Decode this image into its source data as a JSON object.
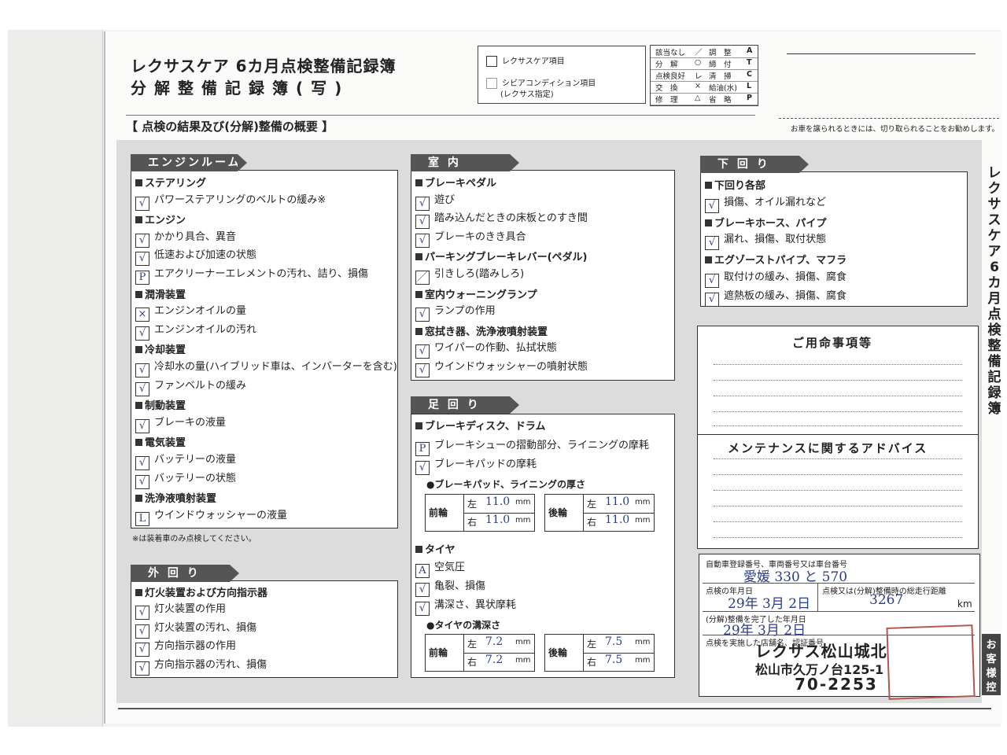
{
  "header": {
    "title_line1": "レクサスケア 6カ月点検整備記録簿",
    "title_line2": "分解整備記録簿(写)",
    "legend": {
      "lexus_care_item": "レクサスケア項目",
      "severe_condition_item": "シビアコンディション項目",
      "severe_condition_note": "(レクサス指定)"
    },
    "codes": [
      {
        "left": "該当なし",
        "left_sym": "／",
        "right": "調　整",
        "right_sym": "A"
      },
      {
        "left": "分　解",
        "left_sym": "○",
        "right": "締　付",
        "right_sym": "T"
      },
      {
        "left": "点検良好",
        "left_sym": "レ",
        "right": "清　掃",
        "right_sym": "C"
      },
      {
        "left": "交　換",
        "left_sym": "×",
        "right": "給油(水)",
        "right_sym": "L"
      },
      {
        "left": "修　理",
        "left_sym": "△",
        "right": "省　略",
        "right_sym": "P"
      }
    ],
    "detach_note": "お車を譲られるときには、切り取られることをお勧めします。",
    "summary_heading": "【 点検の結果及び(分解)整備の概要 】"
  },
  "engine_room": {
    "tab": "エンジンルーム",
    "sections": [
      {
        "heading": "ステアリング",
        "items": [
          {
            "label": "パワーステアリングのベルトの緩み※",
            "mark": "√"
          }
        ]
      },
      {
        "heading": "エンジン",
        "items": [
          {
            "label": "かかり具合、異音",
            "mark": "√"
          },
          {
            "label": "低速および加速の状態",
            "mark": "√"
          },
          {
            "label": "エアクリーナーエレメントの汚れ、詰り、損傷",
            "mark": "P"
          }
        ]
      },
      {
        "heading": "潤滑装置",
        "items": [
          {
            "label": "エンジンオイルの量",
            "mark": "×"
          },
          {
            "label": "エンジンオイルの汚れ",
            "mark": "√"
          }
        ]
      },
      {
        "heading": "冷却装置",
        "items": [
          {
            "label": "冷却水の量(ハイブリッド車は、インバーターを含む)",
            "mark": "√"
          },
          {
            "label": "ファンベルトの緩み",
            "mark": "√"
          }
        ]
      },
      {
        "heading": "制動装置",
        "items": [
          {
            "label": "ブレーキの液量",
            "mark": "√"
          }
        ]
      },
      {
        "heading": "電気装置",
        "items": [
          {
            "label": "バッテリーの液量",
            "mark": "√"
          },
          {
            "label": "バッテリーの状態",
            "mark": "√"
          }
        ]
      },
      {
        "heading": "洗浄液噴射装置",
        "items": [
          {
            "label": "ウインドウォッシャーの液量",
            "mark": "L"
          }
        ]
      }
    ],
    "footnote": "※は装着車のみ点検してください。"
  },
  "exterior": {
    "tab": "外 回 り",
    "heading": "灯火装置および方向指示器",
    "items": [
      {
        "label": "灯火装置の作用",
        "mark": "√"
      },
      {
        "label": "灯火装置の汚れ、損傷",
        "mark": "√"
      },
      {
        "label": "方向指示器の作用",
        "mark": "√"
      },
      {
        "label": "方向指示器の汚れ、損傷",
        "mark": "√"
      }
    ]
  },
  "interior": {
    "tab": "室 内",
    "sections": [
      {
        "heading": "ブレーキペダル",
        "items": [
          {
            "label": "遊び",
            "mark": "√"
          },
          {
            "label": "踏み込んだときの床板とのすき間",
            "mark": "√"
          },
          {
            "label": "ブレーキのきき具合",
            "mark": "√"
          }
        ]
      },
      {
        "heading": "パーキングブレーキレバー(ペダル)",
        "items": [
          {
            "label": "引きしろ(踏みしろ)",
            "mark": "／"
          }
        ]
      },
      {
        "heading": "室内ウォーニングランプ",
        "items": [
          {
            "label": "ランプの作用",
            "mark": "√"
          }
        ]
      },
      {
        "heading": "窓拭き器、洗浄液噴射装置",
        "items": [
          {
            "label": "ワイパーの作動、払拭状態",
            "mark": "√"
          },
          {
            "label": "ウインドウォッシャーの噴射状態",
            "mark": "√"
          }
        ]
      }
    ]
  },
  "wheels": {
    "tab": "足 回 り",
    "brake_heading": "ブレーキディスク、ドラム",
    "brake_items": [
      {
        "label": "ブレーキシューの摺動部分、ライニングの摩耗",
        "mark": "P"
      },
      {
        "label": "ブレーキパッドの摩耗",
        "mark": "√"
      }
    ],
    "pad_heading": "●ブレーキパッド、ライニングの厚さ",
    "pad": {
      "front_label": "前輪",
      "rear_label": "後輪",
      "left": "左",
      "right": "右",
      "unit": "mm",
      "front_left": "11.0",
      "front_right": "11.0",
      "rear_left": "11.0",
      "rear_right": "11.0"
    },
    "tire_heading": "タイヤ",
    "tire_items": [
      {
        "label": "空気圧",
        "mark": "A"
      },
      {
        "label": "亀裂、損傷",
        "mark": "√"
      },
      {
        "label": "溝深さ、異状摩耗",
        "mark": "√"
      }
    ],
    "tread_heading": "●タイヤの溝深さ",
    "tread": {
      "front_label": "前輪",
      "rear_label": "後輪",
      "left": "左",
      "right": "右",
      "unit": "mm",
      "front_left": "7.2",
      "front_right": "7.2",
      "rear_left": "7.5",
      "rear_right": "7.5"
    }
  },
  "underbody": {
    "tab": "下 回 り",
    "sections": [
      {
        "heading": "下回り各部",
        "items": [
          {
            "label": "損傷、オイル漏れなど",
            "mark": "√"
          }
        ]
      },
      {
        "heading": "ブレーキホース、パイプ",
        "items": [
          {
            "label": "漏れ、損傷、取付状態",
            "mark": "√"
          }
        ]
      },
      {
        "heading": "エグゾーストパイプ、マフラ",
        "items": [
          {
            "label": "取付けの緩み、損傷、腐食",
            "mark": "√"
          },
          {
            "label": "遮熱板の緩み、損傷、腐食",
            "mark": "√"
          }
        ]
      }
    ]
  },
  "requests": {
    "title": "ご用命事項等"
  },
  "advice": {
    "title": "メンテナンスに関するアドバイス"
  },
  "registration": {
    "reg_label": "自動車登録番号、車両番号又は車台番号",
    "reg_value": "愛媛 330 と 570",
    "inspect_date_label": "点検の年月日",
    "inspect_date": "29年 3月 2日",
    "mileage_label": "点検又は(分解)整備時の総走行距離",
    "mileage": "3267",
    "mileage_unit": "km",
    "complete_label": "(分解)整備を完了した年月日",
    "complete_date": "29年 3月 2日",
    "shop_label": "点検を実施した店舗名、認証番号",
    "shop_name": "レクサス松山城北",
    "shop_address": "松山市久万ノ台125-1",
    "shop_tel": "70-2253",
    "stamp_text": "レクサス松山城北"
  },
  "side_title": "レクサスケア6カ月点検整備記録簿",
  "customer_tab": "お客様控"
}
